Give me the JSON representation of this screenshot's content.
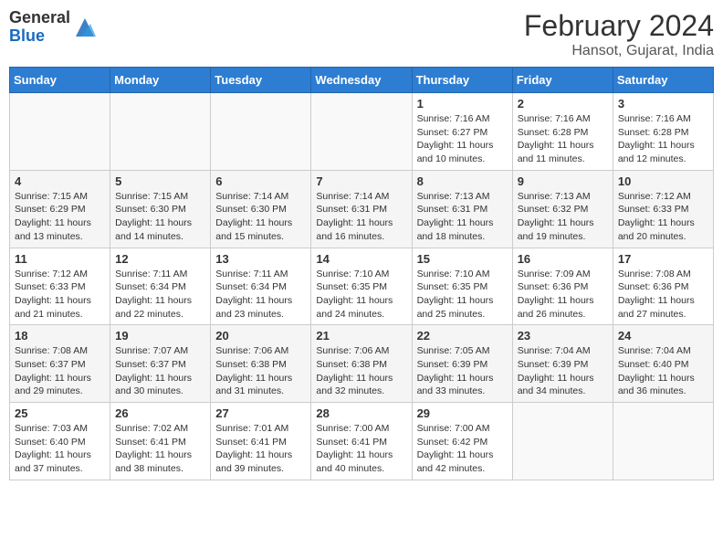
{
  "header": {
    "logo_general": "General",
    "logo_blue": "Blue",
    "month_year": "February 2024",
    "location": "Hansot, Gujarat, India"
  },
  "days_of_week": [
    "Sunday",
    "Monday",
    "Tuesday",
    "Wednesday",
    "Thursday",
    "Friday",
    "Saturday"
  ],
  "weeks": [
    [
      {
        "day": "",
        "empty": true
      },
      {
        "day": "",
        "empty": true
      },
      {
        "day": "",
        "empty": true
      },
      {
        "day": "",
        "empty": true
      },
      {
        "day": "1",
        "sunrise": "7:16 AM",
        "sunset": "6:27 PM",
        "daylight": "11 hours and 10 minutes."
      },
      {
        "day": "2",
        "sunrise": "7:16 AM",
        "sunset": "6:28 PM",
        "daylight": "11 hours and 11 minutes."
      },
      {
        "day": "3",
        "sunrise": "7:16 AM",
        "sunset": "6:28 PM",
        "daylight": "11 hours and 12 minutes."
      }
    ],
    [
      {
        "day": "4",
        "sunrise": "7:15 AM",
        "sunset": "6:29 PM",
        "daylight": "11 hours and 13 minutes."
      },
      {
        "day": "5",
        "sunrise": "7:15 AM",
        "sunset": "6:30 PM",
        "daylight": "11 hours and 14 minutes."
      },
      {
        "day": "6",
        "sunrise": "7:14 AM",
        "sunset": "6:30 PM",
        "daylight": "11 hours and 15 minutes."
      },
      {
        "day": "7",
        "sunrise": "7:14 AM",
        "sunset": "6:31 PM",
        "daylight": "11 hours and 16 minutes."
      },
      {
        "day": "8",
        "sunrise": "7:13 AM",
        "sunset": "6:31 PM",
        "daylight": "11 hours and 18 minutes."
      },
      {
        "day": "9",
        "sunrise": "7:13 AM",
        "sunset": "6:32 PM",
        "daylight": "11 hours and 19 minutes."
      },
      {
        "day": "10",
        "sunrise": "7:12 AM",
        "sunset": "6:33 PM",
        "daylight": "11 hours and 20 minutes."
      }
    ],
    [
      {
        "day": "11",
        "sunrise": "7:12 AM",
        "sunset": "6:33 PM",
        "daylight": "11 hours and 21 minutes."
      },
      {
        "day": "12",
        "sunrise": "7:11 AM",
        "sunset": "6:34 PM",
        "daylight": "11 hours and 22 minutes."
      },
      {
        "day": "13",
        "sunrise": "7:11 AM",
        "sunset": "6:34 PM",
        "daylight": "11 hours and 23 minutes."
      },
      {
        "day": "14",
        "sunrise": "7:10 AM",
        "sunset": "6:35 PM",
        "daylight": "11 hours and 24 minutes."
      },
      {
        "day": "15",
        "sunrise": "7:10 AM",
        "sunset": "6:35 PM",
        "daylight": "11 hours and 25 minutes."
      },
      {
        "day": "16",
        "sunrise": "7:09 AM",
        "sunset": "6:36 PM",
        "daylight": "11 hours and 26 minutes."
      },
      {
        "day": "17",
        "sunrise": "7:08 AM",
        "sunset": "6:36 PM",
        "daylight": "11 hours and 27 minutes."
      }
    ],
    [
      {
        "day": "18",
        "sunrise": "7:08 AM",
        "sunset": "6:37 PM",
        "daylight": "11 hours and 29 minutes."
      },
      {
        "day": "19",
        "sunrise": "7:07 AM",
        "sunset": "6:37 PM",
        "daylight": "11 hours and 30 minutes."
      },
      {
        "day": "20",
        "sunrise": "7:06 AM",
        "sunset": "6:38 PM",
        "daylight": "11 hours and 31 minutes."
      },
      {
        "day": "21",
        "sunrise": "7:06 AM",
        "sunset": "6:38 PM",
        "daylight": "11 hours and 32 minutes."
      },
      {
        "day": "22",
        "sunrise": "7:05 AM",
        "sunset": "6:39 PM",
        "daylight": "11 hours and 33 minutes."
      },
      {
        "day": "23",
        "sunrise": "7:04 AM",
        "sunset": "6:39 PM",
        "daylight": "11 hours and 34 minutes."
      },
      {
        "day": "24",
        "sunrise": "7:04 AM",
        "sunset": "6:40 PM",
        "daylight": "11 hours and 36 minutes."
      }
    ],
    [
      {
        "day": "25",
        "sunrise": "7:03 AM",
        "sunset": "6:40 PM",
        "daylight": "11 hours and 37 minutes."
      },
      {
        "day": "26",
        "sunrise": "7:02 AM",
        "sunset": "6:41 PM",
        "daylight": "11 hours and 38 minutes."
      },
      {
        "day": "27",
        "sunrise": "7:01 AM",
        "sunset": "6:41 PM",
        "daylight": "11 hours and 39 minutes."
      },
      {
        "day": "28",
        "sunrise": "7:00 AM",
        "sunset": "6:41 PM",
        "daylight": "11 hours and 40 minutes."
      },
      {
        "day": "29",
        "sunrise": "7:00 AM",
        "sunset": "6:42 PM",
        "daylight": "11 hours and 42 minutes."
      },
      {
        "day": "",
        "empty": true
      },
      {
        "day": "",
        "empty": true
      }
    ]
  ]
}
